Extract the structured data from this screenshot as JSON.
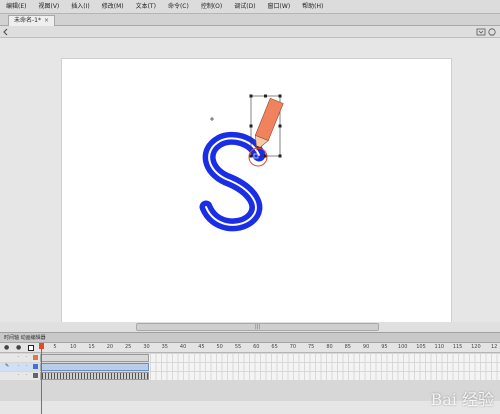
{
  "menubar": {
    "items": [
      "编辑(E)",
      "视图(V)",
      "插入(I)",
      "修改(M)",
      "文本(T)",
      "命令(C)",
      "控制(O)",
      "调试(D)",
      "窗口(W)",
      "帮助(H)"
    ]
  },
  "tabs": {
    "active_label": "未命名-1*",
    "close_glyph": "×"
  },
  "stage": {
    "background": "#ffffff",
    "letter": "S",
    "letter_color": "#1a2ee6",
    "pencil_color": "#f0825e",
    "highlight_circle_color": "#e8462f"
  },
  "scrollbar": {
    "grip": "|||"
  },
  "timeline": {
    "title": "时间轴 动画编辑器",
    "ruler_ticks": [
      "5",
      "10",
      "15",
      "20",
      "25",
      "30",
      "35",
      "40",
      "45",
      "50",
      "55",
      "60",
      "65",
      "70",
      "75",
      "80",
      "85",
      "90",
      "95",
      "100",
      "105",
      "110",
      "115",
      "120",
      "12"
    ],
    "playhead_color": "#e8462f"
  },
  "watermark": {
    "text": "Bai 经验"
  }
}
